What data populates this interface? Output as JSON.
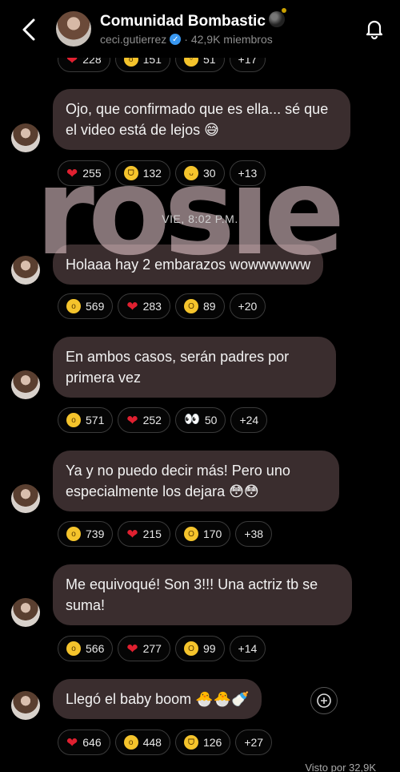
{
  "header": {
    "title": "Comunidad Bombastic",
    "username": "ceci.gutierrez",
    "members": "· 42,9K miembros"
  },
  "watermark": "rosie",
  "time_separator": "VIE, 8:02 P.M.",
  "top_reactions": [
    {
      "icon": "heart",
      "count": "228"
    },
    {
      "icon": "surprised-face",
      "count": "151"
    },
    {
      "icon": "grin-face",
      "count": "51"
    },
    {
      "icon": "more",
      "count": "+17"
    }
  ],
  "messages": [
    {
      "text": "Ojo, que confirmado que es ella... sé que el video está de lejos 😅",
      "reactions": [
        {
          "icon": "heart",
          "count": "255"
        },
        {
          "icon": "laughing-face",
          "count": "132"
        },
        {
          "icon": "tongue-face",
          "count": "30"
        },
        {
          "icon": "more",
          "count": "+13"
        }
      ]
    },
    {
      "text": "Holaaa hay 2 embarazos wowwwwww",
      "reactions": [
        {
          "icon": "surprised-face",
          "count": "569"
        },
        {
          "icon": "heart",
          "count": "283"
        },
        {
          "icon": "screaming-face",
          "count": "89"
        },
        {
          "icon": "more",
          "count": "+20"
        }
      ]
    },
    {
      "text": "En ambos casos, serán padres por primera vez",
      "reactions": [
        {
          "icon": "surprised-face",
          "count": "571"
        },
        {
          "icon": "heart",
          "count": "252"
        },
        {
          "icon": "eyes",
          "count": "50"
        },
        {
          "icon": "more",
          "count": "+24"
        }
      ]
    },
    {
      "text": "Ya y no puedo decir más! Pero uno especialmente los dejara 😳😳",
      "reactions": [
        {
          "icon": "surprised-face",
          "count": "739"
        },
        {
          "icon": "heart",
          "count": "215"
        },
        {
          "icon": "screaming-face",
          "count": "170"
        },
        {
          "icon": "more",
          "count": "+38"
        }
      ]
    },
    {
      "text": "Me equivoqué! Son 3!!! Una actriz tb se suma!",
      "reactions": [
        {
          "icon": "surprised-face",
          "count": "566"
        },
        {
          "icon": "heart",
          "count": "277"
        },
        {
          "icon": "screaming-face",
          "count": "99"
        },
        {
          "icon": "more",
          "count": "+14"
        }
      ]
    },
    {
      "text": "Llegó el baby boom 🐣🐣🍼",
      "reactions": [
        {
          "icon": "heart",
          "count": "646"
        },
        {
          "icon": "surprised-face",
          "count": "448"
        },
        {
          "icon": "laughing-face",
          "count": "126"
        },
        {
          "icon": "more",
          "count": "+27"
        }
      ]
    }
  ],
  "views_label": "Visto por 32,9K"
}
